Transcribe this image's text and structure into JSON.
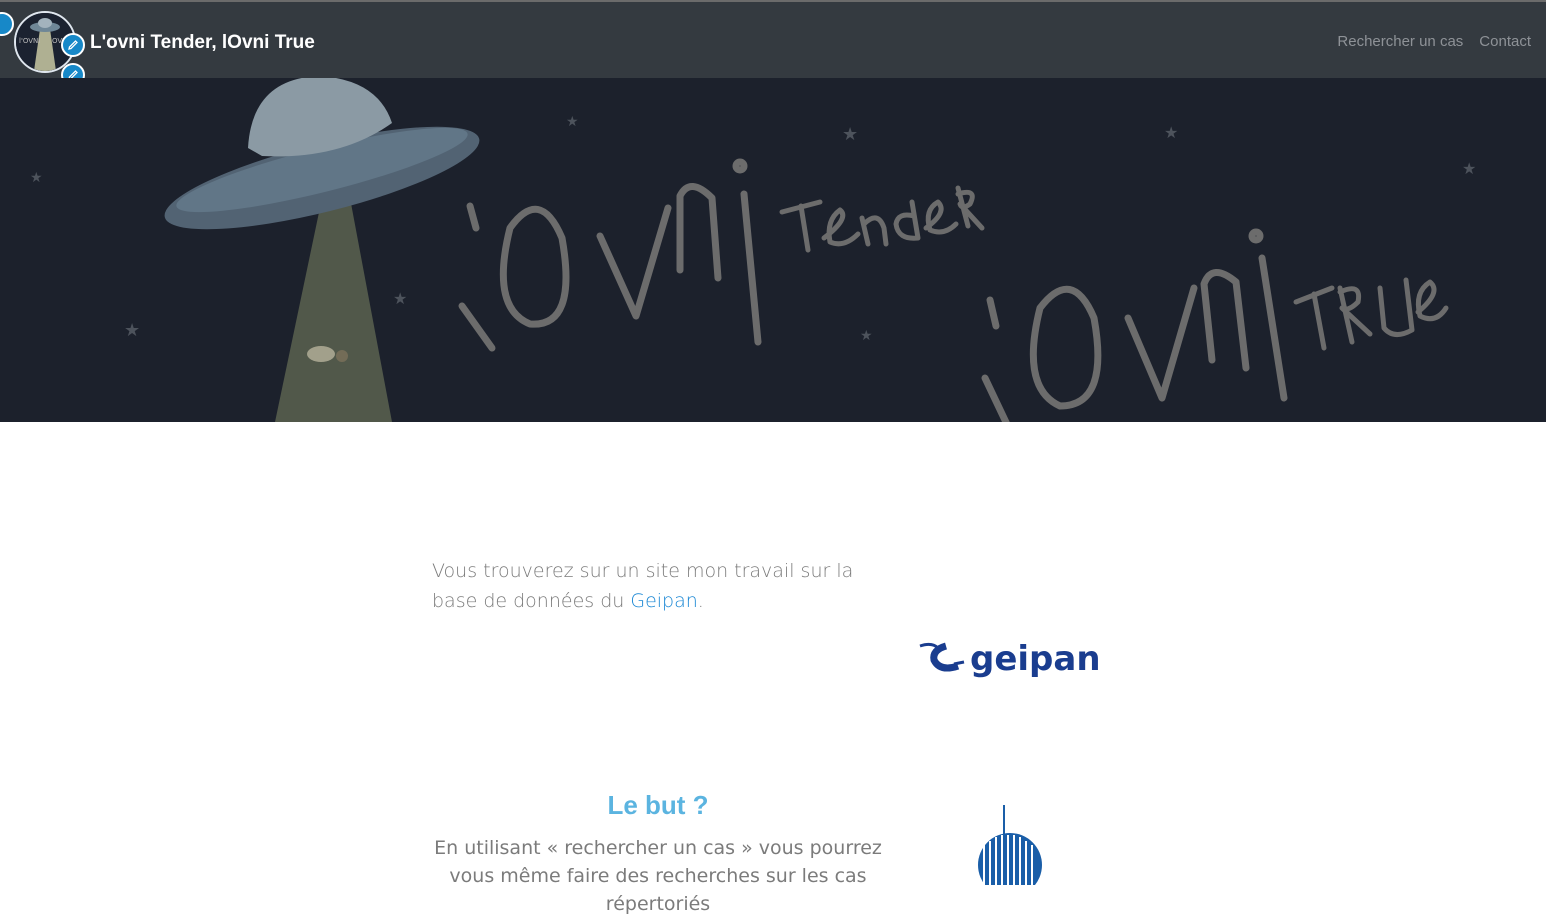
{
  "navbar": {
    "title": "L'ovni Tender, lOvni True",
    "links": [
      "Rechercher un cas",
      "Contact"
    ],
    "background": "#343a40"
  },
  "hero": {
    "banner_words": [
      "l'OVNI",
      "Tender",
      "l'OVNI",
      "TRUE"
    ],
    "background": "#1c212c"
  },
  "intro": {
    "text_before": "Vous trouverez sur un site mon travail sur la base de données du ",
    "link": "Geipan",
    "text_after": "."
  },
  "partner": {
    "logo_text": "geipan",
    "color": "#1a3d8f"
  },
  "purpose": {
    "title": "Le but ?",
    "text": "En utilisant « rechercher un cas » vous pourrez vous même faire des recherches sur les cas répertoriés"
  },
  "icons": [
    "edit-icon",
    "ufo-icon",
    "globe-icon"
  ]
}
